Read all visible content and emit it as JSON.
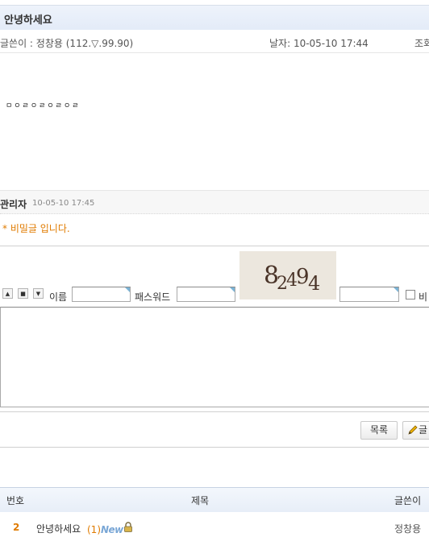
{
  "post": {
    "title": "안녕하세요",
    "author_label": "글쓴이 : 정창용",
    "author_ip": "(112.▽.99.90)",
    "date_label": "날자: 10-05-10 17:44",
    "views_label": "조회",
    "body": "ㅁㅇㄹㅇㄹㅇㄹㅇㄹ"
  },
  "comment": {
    "author": "관리자",
    "date": "10-05-10 17:45",
    "text": "* 비밀글 입니다."
  },
  "form": {
    "btn_up": "▲",
    "btn_mid": "■",
    "btn_down": "▼",
    "name_label": "이름",
    "password_label": "패스워드",
    "captcha_text": "82494",
    "secret_label": "비"
  },
  "buttons": {
    "list": "목록",
    "write": "글"
  },
  "table": {
    "headers": {
      "num": "번호",
      "subject": "제목",
      "author": "글쓴이"
    },
    "rows": [
      {
        "num": "2",
        "subject": "안녕하세요",
        "comment_count": "(1)",
        "badge": "New",
        "author": "정창용"
      }
    ]
  }
}
